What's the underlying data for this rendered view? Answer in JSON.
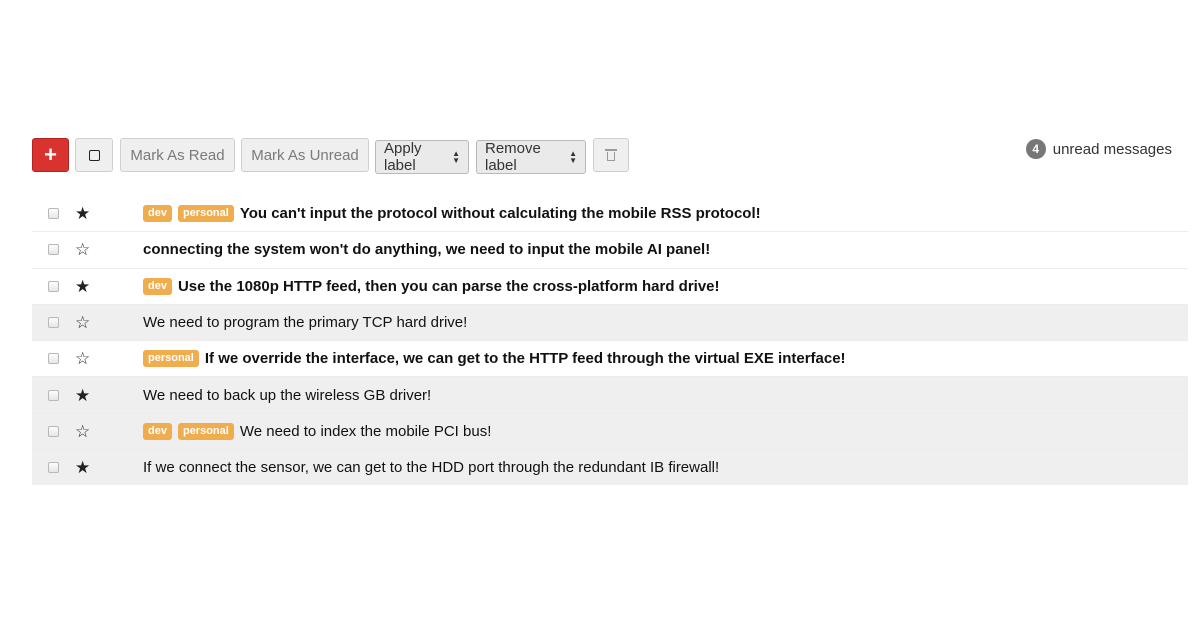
{
  "toolbar": {
    "compose_label": "+",
    "mark_read_label": "Mark As Read",
    "mark_unread_label": "Mark As Unread",
    "apply_label": "Apply label",
    "remove_label": "Remove label"
  },
  "unread": {
    "count": "4",
    "text": "unread messages"
  },
  "colors": {
    "compose": "#d9332f",
    "label": "#f0ad4e",
    "read_row": "#efefef"
  },
  "messages": [
    {
      "starred": true,
      "read": false,
      "labels": [
        "dev",
        "personal"
      ],
      "subject": "You can't input the protocol without calculating the mobile RSS protocol!"
    },
    {
      "starred": false,
      "read": false,
      "labels": [],
      "subject": "connecting the system won't do anything, we need to input the mobile AI panel!"
    },
    {
      "starred": true,
      "read": false,
      "labels": [
        "dev"
      ],
      "subject": "Use the 1080p HTTP feed, then you can parse the cross-platform hard drive!"
    },
    {
      "starred": false,
      "read": true,
      "labels": [],
      "subject": "We need to program the primary TCP hard drive!"
    },
    {
      "starred": false,
      "read": false,
      "labels": [
        "personal"
      ],
      "subject": "If we override the interface, we can get to the HTTP feed through the virtual EXE interface!"
    },
    {
      "starred": true,
      "read": true,
      "labels": [],
      "subject": "We need to back up the wireless GB driver!"
    },
    {
      "starred": false,
      "read": true,
      "labels": [
        "dev",
        "personal"
      ],
      "subject": "We need to index the mobile PCI bus!"
    },
    {
      "starred": true,
      "read": true,
      "labels": [],
      "subject": "If we connect the sensor, we can get to the HDD port through the redundant IB firewall!"
    }
  ]
}
